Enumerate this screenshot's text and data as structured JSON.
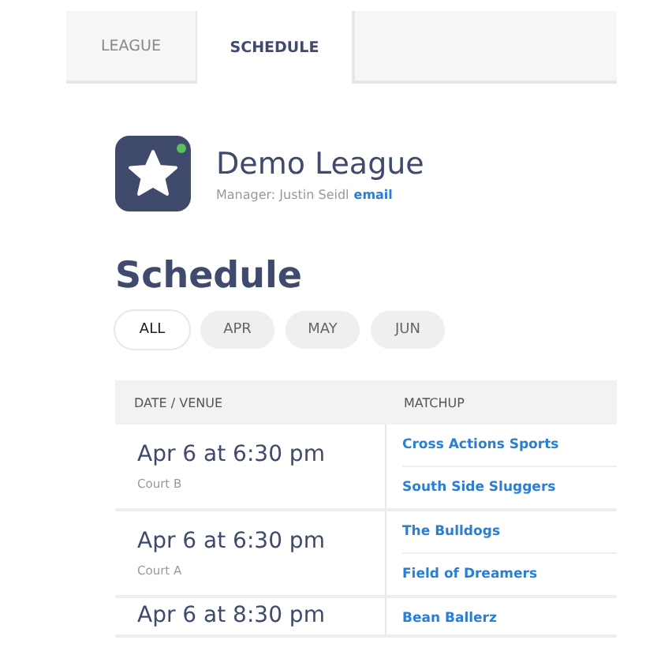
{
  "tabs": [
    {
      "label": "LEAGUE",
      "selected": false
    },
    {
      "label": "SCHEDULE",
      "selected": true
    }
  ],
  "league": {
    "name": "Demo League",
    "manager": "Manager: Justin Seidl",
    "email_link": "email",
    "online": true
  },
  "schedule": {
    "title": "Schedule",
    "filters": [
      {
        "label": "ALL",
        "selected": true
      },
      {
        "label": "APR",
        "selected": false
      },
      {
        "label": "MAY",
        "selected": false
      },
      {
        "label": "JUN",
        "selected": false
      }
    ],
    "columns": [
      "DATE / VENUE",
      "MATCHUP"
    ],
    "rows": [
      {
        "date": "Apr 6 at 6:30 pm",
        "venue": "Court B",
        "teams": [
          "Cross Actions Sports",
          "South Side Sluggers"
        ]
      },
      {
        "date": "Apr 6 at 6:30 pm",
        "venue": "Court A",
        "teams": [
          "The Bulldogs",
          "Field of Dreamers"
        ]
      },
      {
        "date": "Apr 6 at 8:30 pm",
        "teams": [
          "Bean Ballerz"
        ]
      }
    ]
  }
}
